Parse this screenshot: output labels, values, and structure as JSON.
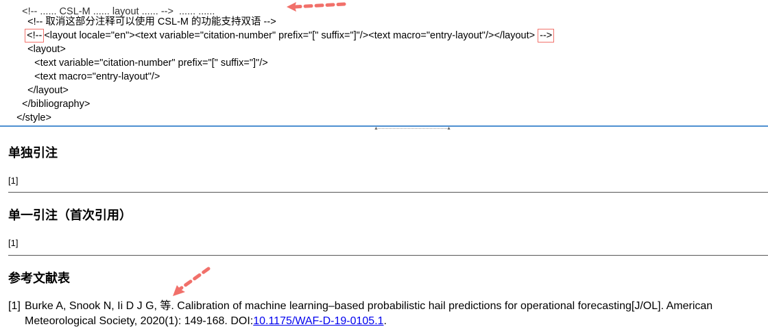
{
  "editor": {
    "clipped_top_line": "<!-- ...... CSL-M ...... layout ...... -->  ...... ......",
    "lines": [
      "<!-- 取消这部分注释可以使用 CSL-M 的功能支持双语 -->",
      "<layout locale=\"en\"><text variable=\"citation-number\" prefix=\"[\" suffix=\"]\"/><text macro=\"entry-layout\"/></layout>",
      "<layout>",
      "<text variable=\"citation-number\" prefix=\"[\" suffix=\"]\"/>",
      "<text macro=\"entry-layout\"/>",
      "</layout>",
      "</bibliography>",
      "</style>"
    ],
    "comment_open": "<!--",
    "comment_close": "-->",
    "highlight_color": "#f1706a",
    "arrow_color": "#f1706a",
    "splitter_color": "#4d8fd1",
    "splitter_grip_icon": "splitter-grip-icon"
  },
  "preview": {
    "sections": [
      {
        "title": "单独引注",
        "citation": "[1]"
      },
      {
        "title": "单一引注（首次引用）",
        "citation": "[1]"
      }
    ],
    "bibliography": {
      "title": "参考文献表",
      "entry": {
        "number": "[1]",
        "text_line1": "Burke A, Snook N, Ii D J G, 等. Calibration of machine learning–based probabilistic hail predictions for operational forecasting[J/OL]. American",
        "text_line2_prefix": "Meteorological Society, 2020(1): 149-168. DOI:",
        "doi": "10.1175/WAF-D-19-0105.1",
        "text_line2_suffix": "."
      }
    },
    "link_color": "#0000ee"
  }
}
